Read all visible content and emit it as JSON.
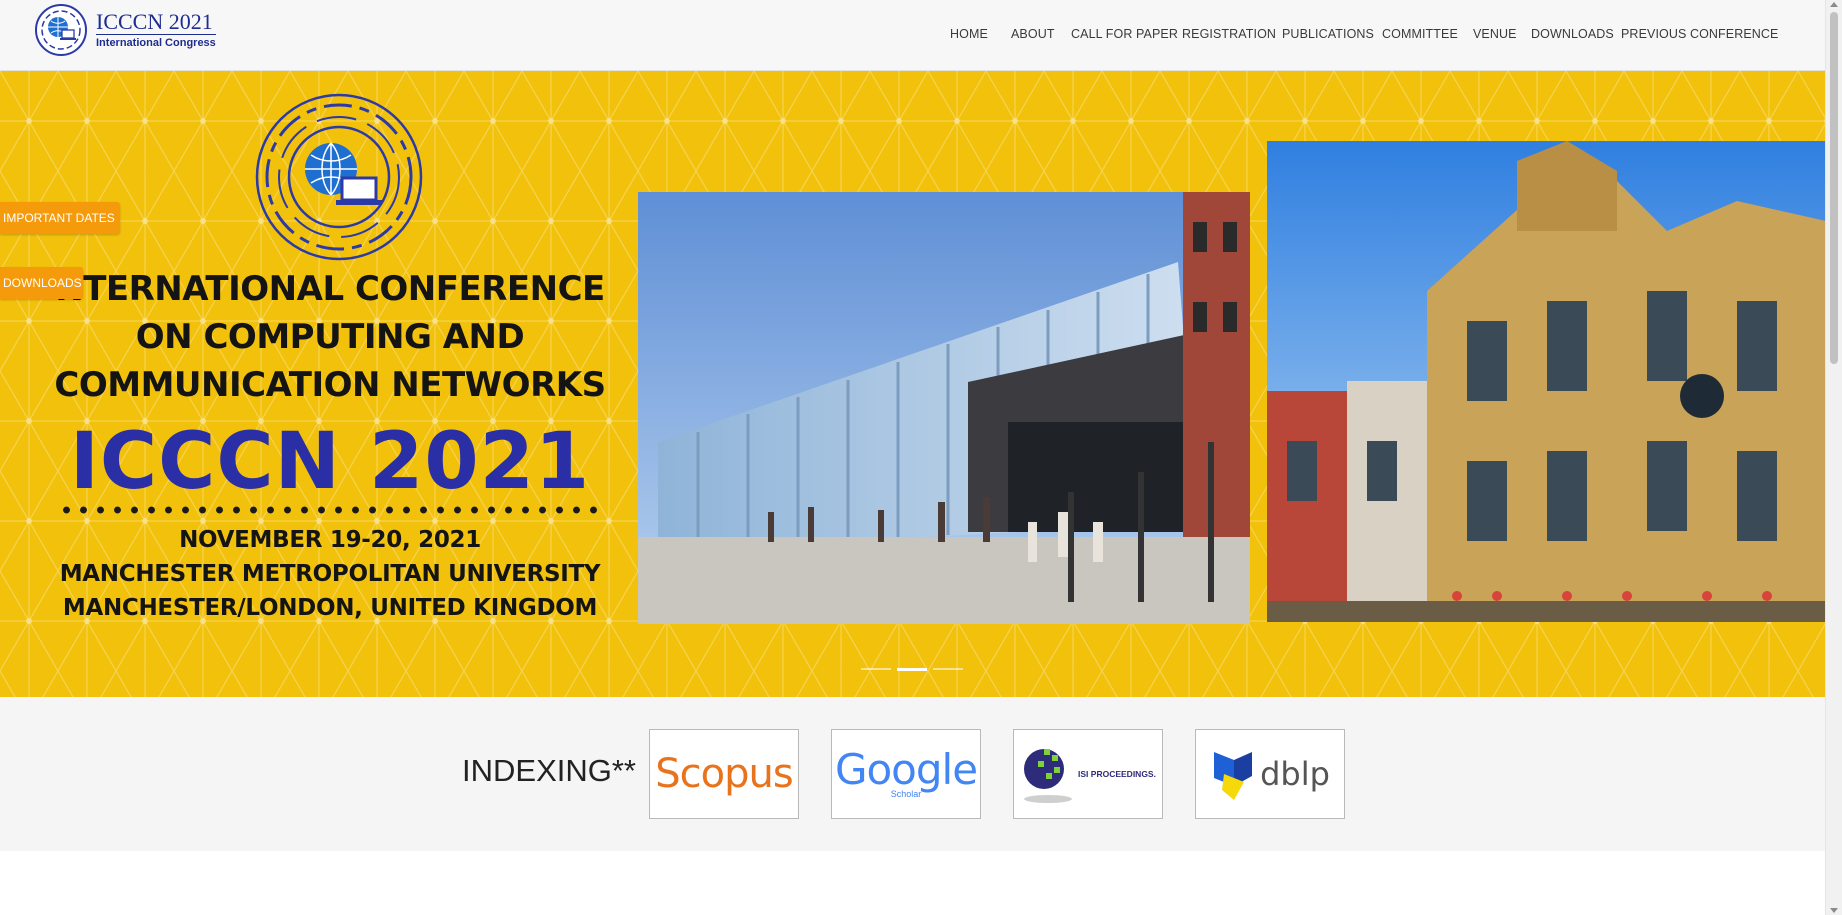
{
  "header": {
    "logo": {
      "title": "ICCCN 2021",
      "subtitle": "International Congress",
      "icon": "globe-laptop-logo-icon"
    },
    "nav": [
      {
        "label": "HOME"
      },
      {
        "label": "ABOUT"
      },
      {
        "label": "CALL FOR PAPER"
      },
      {
        "label": "REGISTRATION"
      },
      {
        "label": "PUBLICATIONS"
      },
      {
        "label": "COMMITTEE"
      },
      {
        "label": "VENUE"
      },
      {
        "label": "DOWNLOADS"
      },
      {
        "label": "PREVIOUS CONFERENCE"
      }
    ]
  },
  "hero": {
    "emblem_icon": "globe-laptop-emblem-icon",
    "title_lines": [
      "NTERNATIONAL CONFERENCE",
      "ON COMPUTING AND",
      "COMMUNICATION NETWORKS"
    ],
    "acronym": "ICCCN 2021",
    "date": "NOVEMBER 19-20, 2021",
    "venue": "MANCHESTER METROPOLITAN UNIVERSITY",
    "location": "MANCHESTER/LONDON, UNITED KINGDOM",
    "slides": {
      "count": 3,
      "active": 2
    }
  },
  "side_buttons": {
    "important_dates": "IMPORTANT DATES",
    "downloads": "DOWNLOADS"
  },
  "indexing": {
    "label": "INDEXING**",
    "logos": [
      {
        "name": "Scopus",
        "text": "Scopus"
      },
      {
        "name": "Google Scholar",
        "text": "Google",
        "sub": "Scholar"
      },
      {
        "name": "ISI Proceedings",
        "text": "ISI PROCEEDINGS."
      },
      {
        "name": "dblp",
        "text": "dblp"
      }
    ]
  },
  "colors": {
    "hero_bg": "#f2c10c",
    "accent_orange": "#f59a0a",
    "brand_blue": "#2b2fa6",
    "nav_text": "#3a3a3a"
  }
}
